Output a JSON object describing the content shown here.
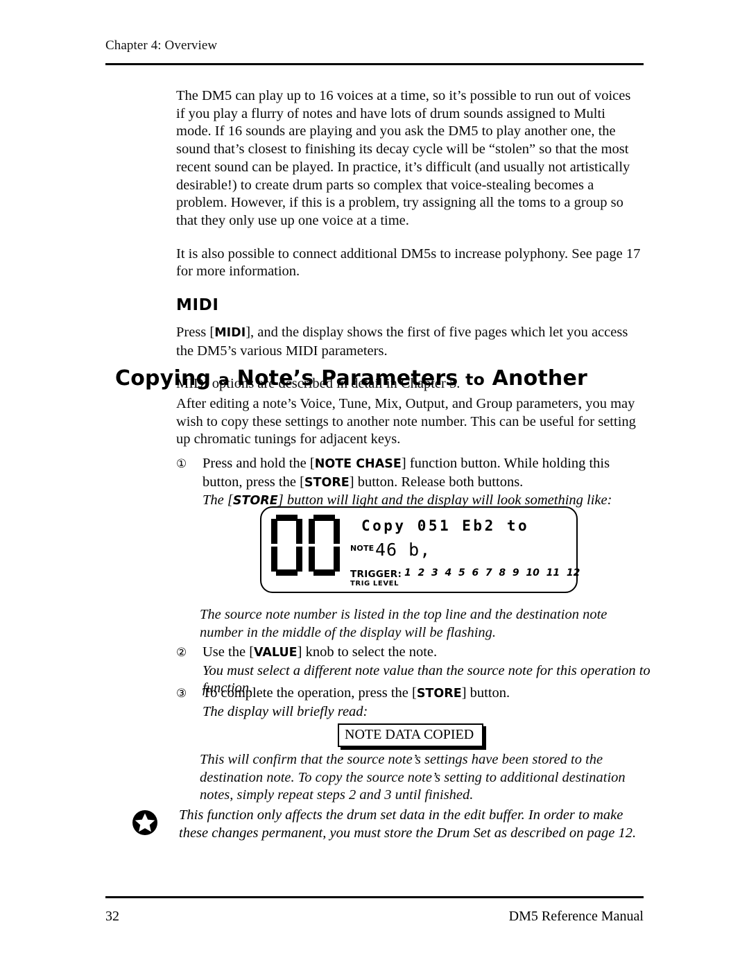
{
  "header": {
    "chapter": "Chapter 4: Overview"
  },
  "body": {
    "para_voices": "The DM5 can play up to 16 voices at a time, so it’s possible to run out of voices if you play a flurry of notes and have lots of drum sounds assigned to Multi mode. If 16 sounds are playing and you ask the DM5 to play another one, the sound that’s closest to finishing its decay cycle will be “stolen” so that the most recent sound can be played. In practice, it’s difficult (and usually not artistically desirable!) to create drum parts so complex that voice-stealing becomes a problem. However, if this is a problem, try assigning all the toms to a group so that they only use up one voice at a time.",
    "para_polyphony": "It is also possible to connect additional DM5s to increase polyphony. See page 17 for more information."
  },
  "midi_section": {
    "heading": "MIDI",
    "press_prefix": "Press ",
    "press_key_open": "[",
    "press_key": "MIDI",
    "press_key_close": "]",
    "press_suffix": ", and the display shows the first of five pages which let you access the DM5’s various MIDI parameters.",
    "options_note": "MIDI options are described in detail in Chapter 5."
  },
  "copy_section": {
    "heading_words": [
      "Copying",
      "a",
      "Note’s",
      "Parameters",
      "to",
      "Another"
    ],
    "intro": "After editing a note’s Voice, Tune, Mix, Output, and Group parameters, you may wish to copy these settings to another note number. This can be useful for setting up chromatic tunings for adjacent keys.",
    "steps": [
      {
        "num": "①",
        "text_a": "Press and hold the ",
        "key_a": "NOTE CHASE",
        "text_b": " function button. While holding this button, press the ",
        "key_b": "STORE",
        "text_c": " button. Release both buttons.",
        "italic_a": "The ",
        "italic_key": "STORE",
        "italic_b": " button will light and the display will look something like:"
      },
      {
        "num": "②",
        "text_a": "Use the ",
        "key_a": "VALUE",
        "text_b": " knob to select the note.",
        "italic_a": "You must select a different note value than the source note for this operation to function."
      },
      {
        "num": "③",
        "text_a": "To complete the operation, press the ",
        "key_a": "STORE",
        "text_b": " button.",
        "italic_a": "The display will briefly read:"
      }
    ],
    "display_caption": "The source note number is listed in the top line and the destination note number in the middle of the display will be flashing.",
    "confirm_box": "NOTE DATA COPIED",
    "confirm_note": "This will confirm that the source note’s settings have been stored to the destination note. To copy the source note’s setting to additional destination notes, simply repeat steps 2 and 3 until finished.",
    "star_note": "This function only affects the drum set data in the edit buffer. In order to make these changes permanent, you must store the Drum Set as described on page 12."
  },
  "lcd": {
    "drumset_digits": [
      "0",
      "0"
    ],
    "line1": "Copy 051 Eb2 to",
    "note_label": "NOTE",
    "note_value": "46 b,",
    "trigger_label": "TRIGGER:",
    "trigger_numbers": "1  2  3  4  5  6  7  8  9  10  11  12",
    "trig_level_label": "TRIG LEVEL"
  },
  "footer": {
    "page_number": "32",
    "manual_title": "DM5 Reference Manual"
  }
}
